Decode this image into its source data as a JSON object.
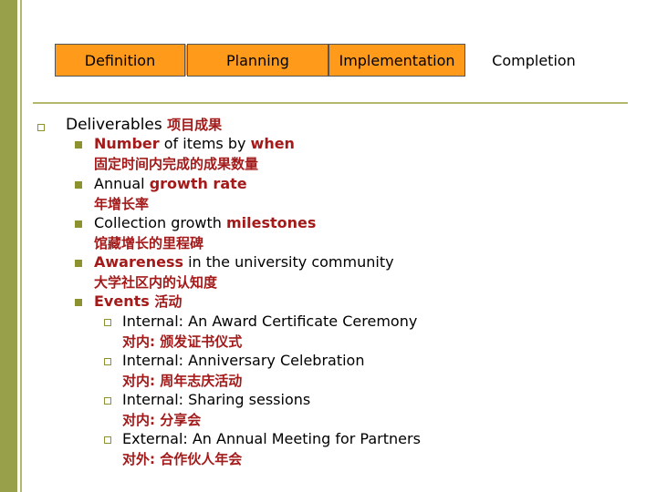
{
  "phases": [
    {
      "label": "Definition"
    },
    {
      "label": "Planning"
    },
    {
      "label": "Implementation"
    },
    {
      "label": "Completion"
    }
  ],
  "colors": {
    "phase_active": "#ff9a1a",
    "accent": "#a41a1a",
    "bar": "#99a04a"
  },
  "deliverables": {
    "prefix": "Deliverables ",
    "cn": "项目成果",
    "items": [
      {
        "a": "Number",
        "b": " of items by ",
        "c": "when",
        "cn": "固定时间内完成的成果数量"
      },
      {
        "a": "Annual ",
        "b": "growth rate",
        "cn": "年增长率"
      },
      {
        "a": "Collection growth ",
        "b": "milestones",
        "cn": "馆藏增长的里程碑"
      },
      {
        "a": "Awareness",
        "b": " in the university community",
        "cn": "大学社区内的认知度"
      },
      {
        "a": "Events ",
        "b": "活动"
      }
    ],
    "events": [
      {
        "en": "Internal: An Award Certificate Ceremony",
        "cn": "对内: 颁发证书仪式"
      },
      {
        "en": "Internal: Anniversary Celebration",
        "cn": "对内: 周年志庆活动"
      },
      {
        "en": "Internal: Sharing sessions",
        "cn": "对内: 分享会"
      },
      {
        "en": "External: An Annual Meeting for Partners",
        "cn": "对外: 合作伙人年会"
      }
    ]
  }
}
